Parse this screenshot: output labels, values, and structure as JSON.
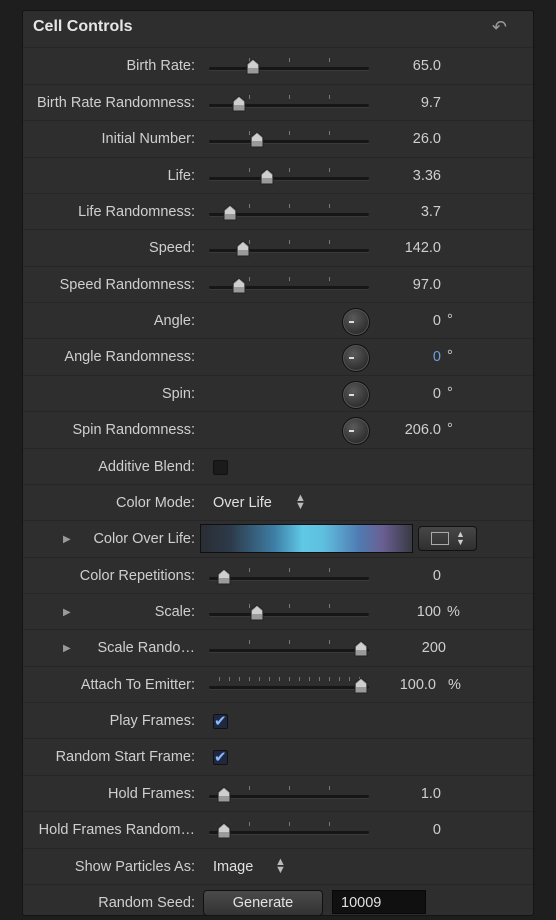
{
  "panel": {
    "title": "Cell Controls"
  },
  "rows": {
    "birth_rate": {
      "label": "Birth Rate:",
      "value": "65.0",
      "level": 0.25
    },
    "birth_rate_rand": {
      "label": "Birth Rate Randomness:",
      "value": "9.7",
      "level": 0.15
    },
    "initial_number": {
      "label": "Initial Number:",
      "value": "26.0",
      "level": 0.28
    },
    "life": {
      "label": "Life:",
      "value": "3.36",
      "level": 0.35
    },
    "life_rand": {
      "label": "Life Randomness:",
      "value": "3.7",
      "level": 0.09
    },
    "speed": {
      "label": "Speed:",
      "value": "142.0",
      "level": 0.18
    },
    "speed_rand": {
      "label": "Speed Randomness:",
      "value": "97.0",
      "level": 0.15
    },
    "angle": {
      "label": "Angle:",
      "value": "0",
      "unit": "°"
    },
    "angle_rand": {
      "label": "Angle Randomness:",
      "value": "0",
      "unit": "°"
    },
    "spin": {
      "label": "Spin:",
      "value": "0",
      "unit": "°"
    },
    "spin_rand": {
      "label": "Spin Randomness:",
      "value": "206.0",
      "unit": "°"
    },
    "additive_blend": {
      "label": "Additive Blend:",
      "checked": false
    },
    "color_mode": {
      "label": "Color Mode:",
      "value": "Over Life"
    },
    "color_over_life": {
      "label": "Color Over Life:"
    },
    "color_reps": {
      "label": "Color Repetitions:",
      "value": "0",
      "level": 0.05
    },
    "scale": {
      "label": "Scale:",
      "value": "100",
      "unit": "%",
      "level": 0.28
    },
    "scale_rand": {
      "label": "Scale Rando…",
      "value": "200",
      "level": 1.0
    },
    "attach": {
      "label": "Attach To Emitter:",
      "value": "100.0",
      "unit": "%",
      "level": 1.0
    },
    "play_frames": {
      "label": "Play Frames:",
      "checked": true
    },
    "random_start": {
      "label": "Random Start Frame:",
      "checked": true
    },
    "hold_frames": {
      "label": "Hold Frames:",
      "value": "1.0",
      "level": 0.05
    },
    "hold_frames_rand": {
      "label": "Hold Frames Random…",
      "value": "0",
      "level": 0.05
    },
    "show_particles": {
      "label": "Show Particles As:",
      "value": "Image"
    },
    "random_seed": {
      "label": "Random Seed:",
      "button": "Generate",
      "value": "10009"
    }
  }
}
